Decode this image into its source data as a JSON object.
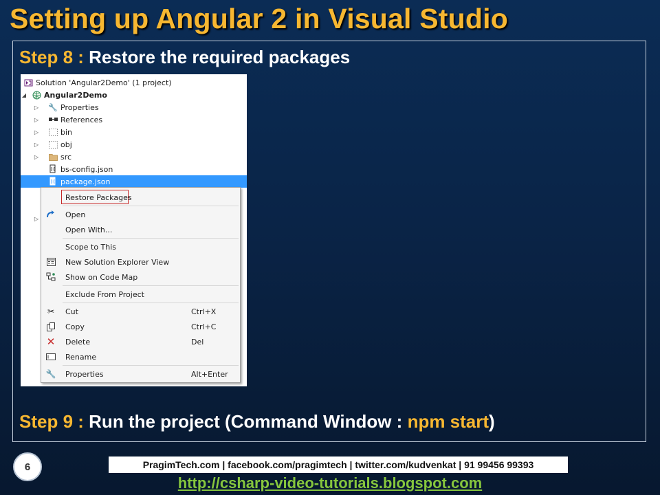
{
  "title": "Setting up Angular 2 in Visual Studio",
  "step8": {
    "label": "Step 8 :",
    "text": "Restore the required packages"
  },
  "step9": {
    "label": "Step 9 :",
    "text_before": "Run the project (Command Window : ",
    "highlight": "npm start",
    "text_after": ")"
  },
  "explorer": {
    "solution": "Solution 'Angular2Demo' (1 project)",
    "project": "Angular2Demo",
    "items": [
      "Properties",
      "References",
      "bin",
      "obj",
      "src",
      "bs-config.json",
      "package.json"
    ],
    "selected_item": "package.json"
  },
  "context_menu": {
    "items": [
      {
        "label": "Restore Packages",
        "shortcut": "",
        "icon": "none"
      },
      {
        "label": "Open",
        "shortcut": "",
        "icon": "open-arrow-icon"
      },
      {
        "label": "Open With...",
        "shortcut": "",
        "icon": "none"
      },
      {
        "label": "Scope to This",
        "shortcut": "",
        "icon": "none"
      },
      {
        "label": "New Solution Explorer View",
        "shortcut": "",
        "icon": "new-view-icon"
      },
      {
        "label": "Show on Code Map",
        "shortcut": "",
        "icon": "code-map-icon"
      },
      {
        "label": "Exclude From Project",
        "shortcut": "",
        "icon": "none"
      },
      {
        "label": "Cut",
        "shortcut": "Ctrl+X",
        "icon": "scissors-icon"
      },
      {
        "label": "Copy",
        "shortcut": "Ctrl+C",
        "icon": "copy-icon"
      },
      {
        "label": "Delete",
        "shortcut": "Del",
        "icon": "delete-x-icon"
      },
      {
        "label": "Rename",
        "shortcut": "",
        "icon": "rename-icon"
      },
      {
        "label": "Properties",
        "shortcut": "Alt+Enter",
        "icon": "wrench-icon"
      }
    ]
  },
  "footer": {
    "page_number": "6",
    "contact": "PragimTech.com | facebook.com/pragimtech | twitter.com/kudvenkat | 91 99456 99393",
    "blog_link": "http://csharp-video-tutorials.blogspot.com"
  },
  "colors": {
    "title": "#f7b731",
    "background": "#0a2447",
    "link": "#86c63d",
    "selection": "#3399ff"
  }
}
